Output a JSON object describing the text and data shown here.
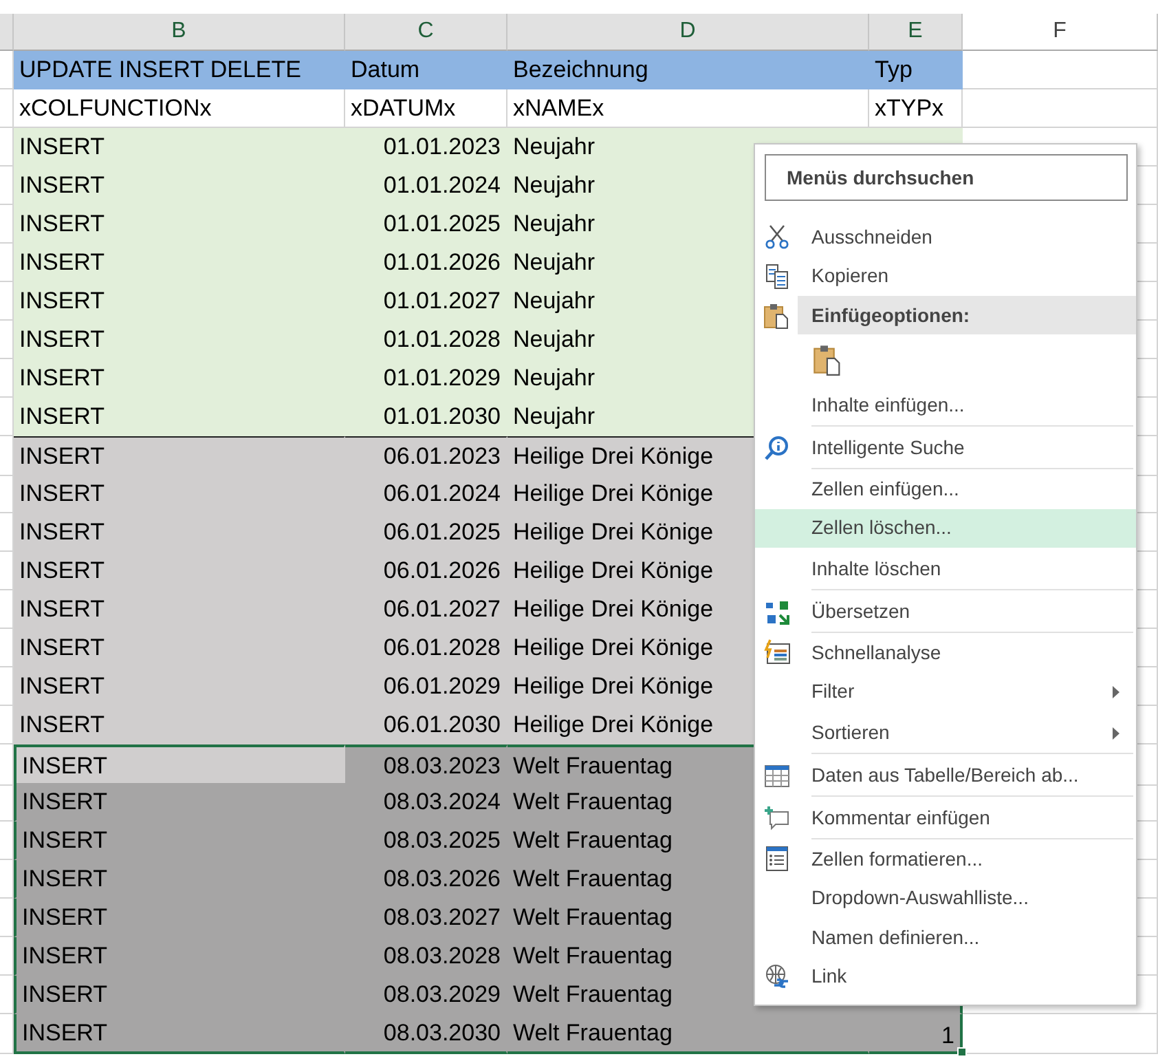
{
  "columns": [
    {
      "letter": "B"
    },
    {
      "letter": "C"
    },
    {
      "letter": "D"
    },
    {
      "letter": "E"
    },
    {
      "letter": "F"
    }
  ],
  "header_row": {
    "color": "#8db4e2",
    "cells": [
      "UPDATE INSERT DELETE",
      "Datum",
      "Bezeichnung",
      "Typ"
    ]
  },
  "field_row": [
    "xCOLFUNCTIONx",
    "xDATUMx",
    "xNAMEx",
    "xTYPx"
  ],
  "rows": [
    {
      "function": "INSERT",
      "date": "01.01.2023",
      "name": "Neujahr",
      "color": "#e2efda",
      "selected": false,
      "active": false
    },
    {
      "function": "INSERT",
      "date": "01.01.2024",
      "name": "Neujahr",
      "color": "#e2efda",
      "selected": false,
      "active": false
    },
    {
      "function": "INSERT",
      "date": "01.01.2025",
      "name": "Neujahr",
      "color": "#e2efda",
      "selected": false,
      "active": false
    },
    {
      "function": "INSERT",
      "date": "01.01.2026",
      "name": "Neujahr",
      "color": "#e2efda",
      "selected": false,
      "active": false
    },
    {
      "function": "INSERT",
      "date": "01.01.2027",
      "name": "Neujahr",
      "color": "#e2efda",
      "selected": false,
      "active": false
    },
    {
      "function": "INSERT",
      "date": "01.01.2028",
      "name": "Neujahr",
      "color": "#e2efda",
      "selected": false,
      "active": false
    },
    {
      "function": "INSERT",
      "date": "01.01.2029",
      "name": "Neujahr",
      "color": "#e2efda",
      "selected": false,
      "active": false
    },
    {
      "function": "INSERT",
      "date": "01.01.2030",
      "name": "Neujahr",
      "color": "#e2efda",
      "selected": false,
      "active": false
    },
    {
      "function": "INSERT",
      "date": "06.01.2023",
      "name": "Heilige Drei Könige",
      "color": "#d0cece",
      "selected": false,
      "active": false
    },
    {
      "function": "INSERT",
      "date": "06.01.2024",
      "name": "Heilige Drei Könige",
      "color": "#d0cece",
      "selected": false,
      "active": false
    },
    {
      "function": "INSERT",
      "date": "06.01.2025",
      "name": "Heilige Drei Könige",
      "color": "#d0cece",
      "selected": false,
      "active": false
    },
    {
      "function": "INSERT",
      "date": "06.01.2026",
      "name": "Heilige Drei Könige",
      "color": "#d0cece",
      "selected": false,
      "active": false
    },
    {
      "function": "INSERT",
      "date": "06.01.2027",
      "name": "Heilige Drei Könige",
      "color": "#d0cece",
      "selected": false,
      "active": false
    },
    {
      "function": "INSERT",
      "date": "06.01.2028",
      "name": "Heilige Drei Könige",
      "color": "#d0cece",
      "selected": false,
      "active": false
    },
    {
      "function": "INSERT",
      "date": "06.01.2029",
      "name": "Heilige Drei Könige",
      "color": "#d0cece",
      "selected": false,
      "active": false
    },
    {
      "function": "INSERT",
      "date": "06.01.2030",
      "name": "Heilige Drei Könige",
      "color": "#d0cece",
      "selected": false,
      "active": false
    },
    {
      "function": "INSERT",
      "date": "08.03.2023",
      "name": "Welt Frauentag",
      "color": "#a6a5a5",
      "selected": true,
      "active": true
    },
    {
      "function": "INSERT",
      "date": "08.03.2024",
      "name": "Welt Frauentag",
      "color": "#a6a5a5",
      "selected": true,
      "active": false
    },
    {
      "function": "INSERT",
      "date": "08.03.2025",
      "name": "Welt Frauentag",
      "color": "#a6a5a5",
      "selected": true,
      "active": false
    },
    {
      "function": "INSERT",
      "date": "08.03.2026",
      "name": "Welt Frauentag",
      "color": "#a6a5a5",
      "selected": true,
      "active": false
    },
    {
      "function": "INSERT",
      "date": "08.03.2027",
      "name": "Welt Frauentag",
      "color": "#a6a5a5",
      "selected": true,
      "active": false
    },
    {
      "function": "INSERT",
      "date": "08.03.2028",
      "name": "Welt Frauentag",
      "color": "#a6a5a5",
      "selected": true,
      "active": false
    },
    {
      "function": "INSERT",
      "date": "08.03.2029",
      "name": "Welt Frauentag",
      "color": "#a6a5a5",
      "selected": true,
      "active": false
    },
    {
      "function": "INSERT",
      "date": "08.03.2030",
      "name": "Welt Frauentag",
      "color": "#a6a5a5",
      "selected": true,
      "active": false,
      "type": "1"
    }
  ],
  "context_menu": {
    "search": {
      "placeholder": "Menüs durchsuchen"
    },
    "items": [
      {
        "kind": "item",
        "label": "Ausschneiden",
        "selected": false
      },
      {
        "kind": "item",
        "label": "Kopieren",
        "selected": false
      },
      {
        "kind": "header",
        "label": "Einfügeoptionen:"
      },
      {
        "kind": "paste",
        "selected": false
      },
      {
        "kind": "item",
        "label": "Inhalte einfügen...",
        "selected": false,
        "separator_after": true
      },
      {
        "kind": "item",
        "label": "Intelligente Suche",
        "selected": false,
        "separator_after": true
      },
      {
        "kind": "item",
        "label": "Zellen einfügen...",
        "selected": false
      },
      {
        "kind": "item",
        "label": "Zellen löschen...",
        "selected": true
      },
      {
        "kind": "item",
        "label": "Inhalte löschen",
        "selected": false,
        "separator_after": true
      },
      {
        "kind": "item",
        "label": "Übersetzen",
        "selected": false,
        "separator_after": true
      },
      {
        "kind": "item",
        "label": "Schnellanalyse",
        "selected": false
      },
      {
        "kind": "item",
        "label": "Filter",
        "selected": false,
        "submenu": true
      },
      {
        "kind": "item",
        "label": "Sortieren",
        "selected": false,
        "submenu": true,
        "separator_after": true
      },
      {
        "kind": "item",
        "label": "Daten aus Tabelle/Bereich ab...",
        "selected": false,
        "separator_after": true
      },
      {
        "kind": "item",
        "label": "Kommentar einfügen",
        "selected": false,
        "separator_after": true
      },
      {
        "kind": "item",
        "label": "Zellen formatieren...",
        "selected": false
      },
      {
        "kind": "item",
        "label": "Dropdown-Auswahlliste...",
        "selected": false
      },
      {
        "kind": "item",
        "label": "Namen definieren...",
        "selected": false
      },
      {
        "kind": "item",
        "label": "Link",
        "selected": false
      }
    ]
  }
}
